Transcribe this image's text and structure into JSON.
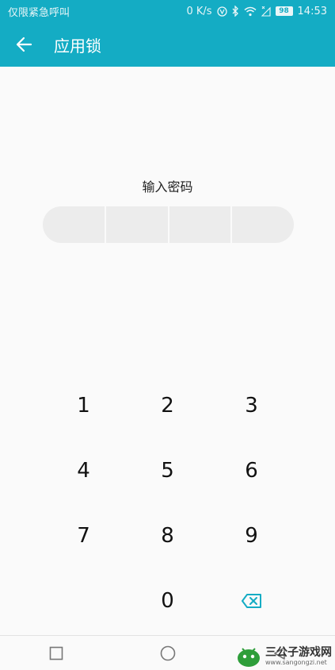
{
  "status_bar": {
    "carrier": "仅限紧急呼叫",
    "network_speed": "0 K/s",
    "battery": "98",
    "time": "14:53",
    "background": "#14acc4"
  },
  "app_bar": {
    "title": "应用锁",
    "background": "#14acc4"
  },
  "pin": {
    "prompt": "输入密码",
    "length": 4,
    "entered": 0
  },
  "keypad": {
    "keys": [
      "1",
      "2",
      "3",
      "4",
      "5",
      "6",
      "7",
      "8",
      "9",
      "",
      "0",
      "backspace-icon"
    ],
    "accent": "#14acc4"
  },
  "nav_bar": {
    "buttons": [
      "recents-icon",
      "home-icon",
      "back-icon"
    ]
  },
  "watermark": {
    "text": "三公子游戏网",
    "url": "www.sangongzi.net"
  }
}
